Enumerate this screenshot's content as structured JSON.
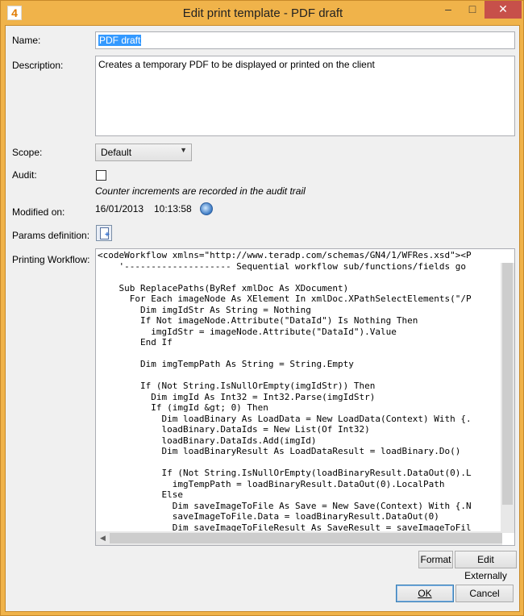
{
  "window": {
    "title": "Edit print template - PDF draft",
    "app_icon_text": "4",
    "minimize": "–",
    "maximize": "□",
    "close": "✕"
  },
  "form": {
    "name_label": "Name:",
    "name_value": "PDF draft",
    "description_label": "Description:",
    "description_value": "Creates a temporary PDF to be displayed or printed on the client",
    "scope_label": "Scope:",
    "scope_value": "Default",
    "audit_label": "Audit:",
    "audit_checked": false,
    "audit_note": "Counter increments are recorded in the audit trail",
    "modified_label": "Modified on:",
    "modified_date": "16/01/2013",
    "modified_time": "10:13:58",
    "params_label": "Params definition:",
    "workflow_label": "Printing Workflow:",
    "workflow_code": "<codeWorkflow xmlns=\"http://www.teradp.com/schemas/GN4/1/WFRes.xsd\"><P\n    '-------------------- Sequential workflow sub/functions/fields go\n\n    Sub ReplacePaths(ByRef xmlDoc As XDocument)\n      For Each imageNode As XElement In xmlDoc.XPathSelectElements(\"/P\n        Dim imgIdStr As String = Nothing\n        If Not imageNode.Attribute(\"DataId\") Is Nothing Then\n          imgIdStr = imageNode.Attribute(\"DataId\").Value\n        End If\n\n        Dim imgTempPath As String = String.Empty\n\n        If (Not String.IsNullOrEmpty(imgIdStr)) Then\n          Dim imgId As Int32 = Int32.Parse(imgIdStr)\n          If (imgId &gt; 0) Then\n            Dim loadBinary As LoadData = New LoadData(Context) With {.\n            loadBinary.DataIds = New List(Of Int32)\n            loadBinary.DataIds.Add(imgId)\n            Dim loadBinaryResult As LoadDataResult = loadBinary.Do()\n\n            If (Not String.IsNullOrEmpty(loadBinaryResult.DataOut(0).L\n              imgTempPath = loadBinaryResult.DataOut(0).LocalPath\n            Else\n              Dim saveImageToFile As Save = New Save(Context) With {.N\n              saveImageToFile.Data = loadBinaryResult.DataOut(0)\n              Dim saveImageToFileResult As SaveResult = saveImageToFil"
  },
  "buttons": {
    "format": "Format",
    "edit_externally": "Edit Externally",
    "ok": "OK",
    "cancel": "Cancel"
  },
  "icons": {
    "globe": "globe-icon",
    "params": "add-document-icon"
  },
  "colors": {
    "frame": "#f0b34a",
    "close": "#c7504a",
    "selection": "#3399ff"
  }
}
